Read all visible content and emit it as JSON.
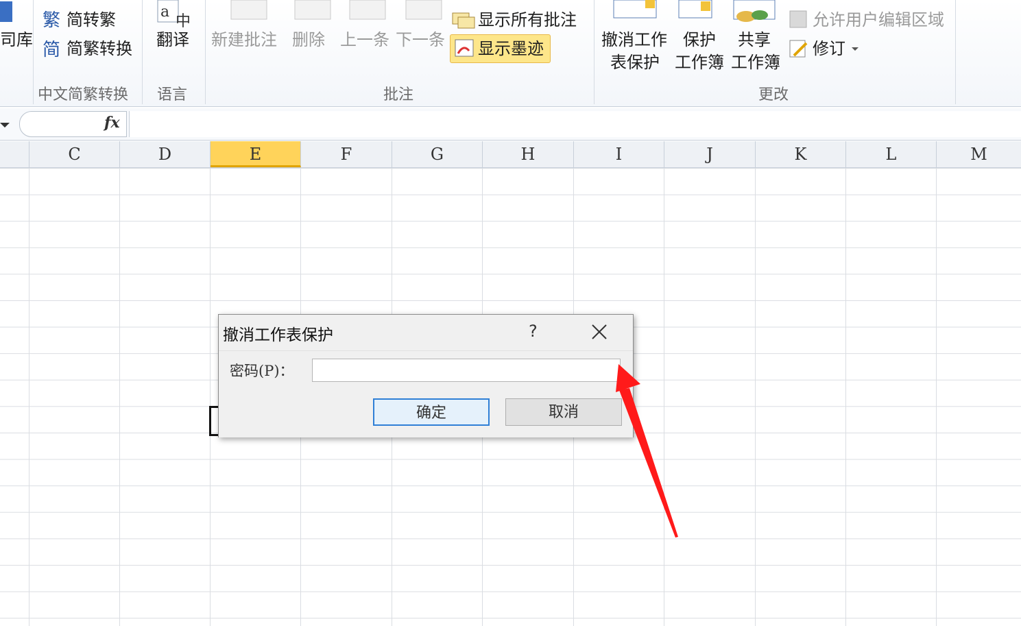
{
  "ribbon": {
    "left_fragment": "司库",
    "chinese_conversion": {
      "to_traditional": "简转繁",
      "to_simplified": "繁转简",
      "convert": "简繁转换",
      "group_label": "中文简繁转换"
    },
    "language": {
      "translate": "翻译",
      "group_label": "语言"
    },
    "comments": {
      "new_comment": "新建批注",
      "delete": "删除",
      "previous": "上一条",
      "next": "下一条",
      "show_all_comments": "显示所有批注",
      "show_ink": "显示墨迹",
      "group_label": "批注"
    },
    "changes": {
      "unprotect_sheet_line1": "撤消工作",
      "unprotect_sheet_line2": "表保护",
      "protect_workbook_line1": "保护",
      "protect_workbook_line2": "工作簿",
      "share_workbook_line1": "共享",
      "share_workbook_line2": "工作簿",
      "allow_edit_ranges": "允许用户编辑区域",
      "track_changes": "修订",
      "group_label": "更改"
    }
  },
  "formula_bar": {
    "fx_label": "fx",
    "value": ""
  },
  "columns": [
    "C",
    "D",
    "E",
    "F",
    "G",
    "H",
    "I",
    "J",
    "K",
    "L",
    "M"
  ],
  "selected_column": "E",
  "dialog": {
    "title": "撤消工作表保护",
    "help": "?",
    "password_label": "密码(P)：",
    "password_value": "",
    "ok": "确定",
    "cancel": "取消"
  },
  "colors": {
    "selected_column": "#ffd35a",
    "annotation_arrow": "#ff1a1a",
    "ok_border": "#2f7fd6"
  }
}
